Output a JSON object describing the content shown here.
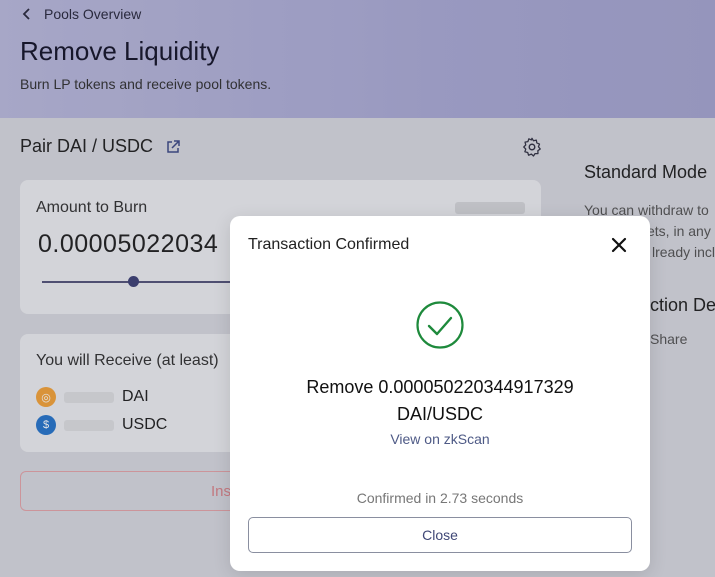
{
  "header": {
    "back_label": "Pools Overview",
    "title": "Remove Liquidity",
    "subtitle": "Burn LP tokens and receive pool tokens."
  },
  "pair": {
    "label": "Pair DAI / USDC"
  },
  "burn": {
    "label": "Amount to Burn",
    "value": "0.00005022034"
  },
  "receive": {
    "label": "You will Receive (at least)",
    "tokens": [
      {
        "symbol": "DAI",
        "color": "#f2a23a"
      },
      {
        "symbol": "USDC",
        "color": "#2775ca"
      }
    ]
  },
  "action_button": {
    "label": "Ins"
  },
  "side_panel": {
    "heading": "Standard Mode",
    "text_lines": [
      "You can withdraw to",
      "ets, in any",
      "lready incl"
    ],
    "heading2": "ction De",
    "share_label": "Share"
  },
  "modal": {
    "title": "Transaction Confirmed",
    "message_line1": "Remove 0.000050220344917329",
    "message_line2": "DAI/USDC",
    "link_label": "View on zkScan",
    "confirmed_text": "Confirmed in 2.73 seconds",
    "close_label": "Close",
    "success_color": "#1e8a3c"
  }
}
